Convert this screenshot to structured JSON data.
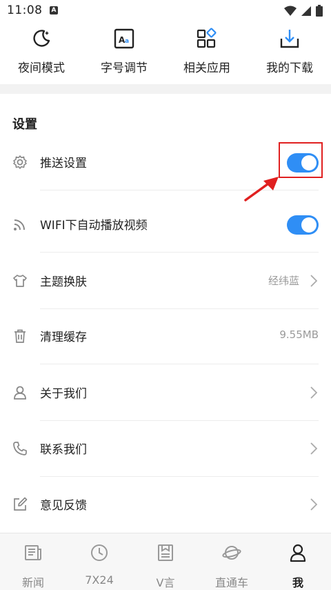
{
  "status_bar": {
    "time": "11:08",
    "notification_badge": "A"
  },
  "quick_actions": [
    {
      "label": "夜间模式",
      "icon": "moon-icon"
    },
    {
      "label": "字号调节",
      "icon": "font-size-icon"
    },
    {
      "label": "相关应用",
      "icon": "apps-grid-icon"
    },
    {
      "label": "我的下载",
      "icon": "download-icon"
    }
  ],
  "settings": {
    "title": "设置",
    "items": [
      {
        "label": "推送设置",
        "icon": "gear-icon",
        "toggle": true
      },
      {
        "label": "WIFI下自动播放视频",
        "icon": "wifi-icon",
        "toggle": true
      },
      {
        "label": "主题换肤",
        "icon": "tshirt-icon",
        "value": "经纬蓝"
      },
      {
        "label": "清理缓存",
        "icon": "trash-icon",
        "value": "9.55MB"
      },
      {
        "label": "关于我们",
        "icon": "user-icon"
      },
      {
        "label": "联系我们",
        "icon": "phone-icon"
      },
      {
        "label": "意见反馈",
        "icon": "edit-icon"
      }
    ]
  },
  "annotation": {
    "highlight_color": "#e02020"
  },
  "tabs": [
    {
      "label": "新闻",
      "icon": "news-icon",
      "active": false
    },
    {
      "label": "7X24",
      "icon": "clock-icon",
      "active": false
    },
    {
      "label": "V言",
      "icon": "document-icon",
      "active": false
    },
    {
      "label": "直通车",
      "icon": "planet-icon",
      "active": false
    },
    {
      "label": "我",
      "icon": "profile-icon",
      "active": true
    }
  ],
  "colors": {
    "accent": "#2f8ef5",
    "text": "#222222",
    "muted": "#9a9a9a"
  }
}
